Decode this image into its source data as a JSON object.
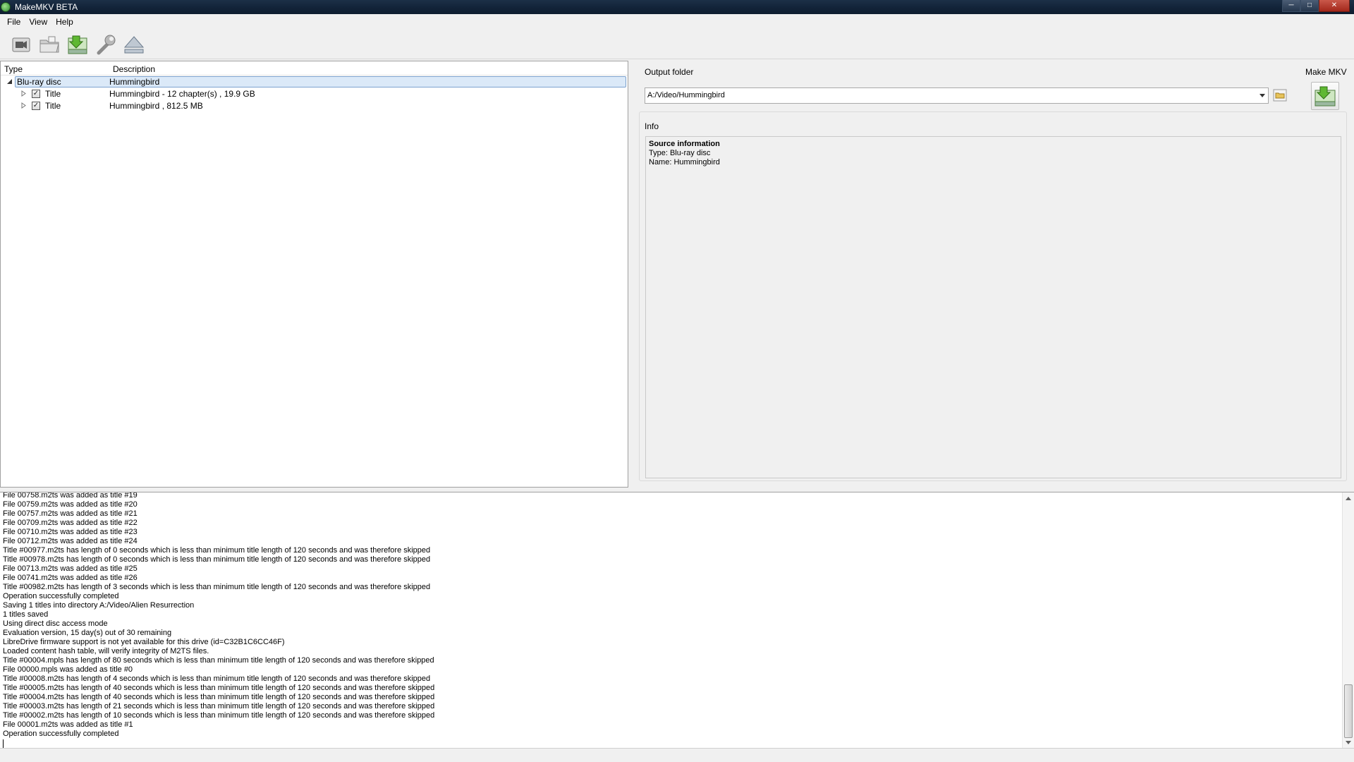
{
  "window": {
    "title": "MakeMKV BETA"
  },
  "menu": {
    "items": [
      "File",
      "View",
      "Help"
    ]
  },
  "tree": {
    "columns": {
      "type": "Type",
      "description": "Description"
    },
    "rows": [
      {
        "type": "Blu-ray disc",
        "description": "Hummingbird"
      },
      {
        "type": "Title",
        "description": "Hummingbird - 12 chapter(s) , 19.9 GB"
      },
      {
        "type": "Title",
        "description": "Hummingbird , 812.5 MB"
      }
    ]
  },
  "output": {
    "label": "Output folder",
    "value": "A:/Video/Hummingbird"
  },
  "make_mkv": {
    "label": "Make MKV"
  },
  "info": {
    "label": "Info",
    "heading": "Source information",
    "lines": [
      "Type: Blu-ray disc",
      "Name: Hummingbird"
    ]
  },
  "log": {
    "lines": [
      "File 00758.m2ts was added as title #19",
      "File 00759.m2ts was added as title #20",
      "File 00757.m2ts was added as title #21",
      "File 00709.m2ts was added as title #22",
      "File 00710.m2ts was added as title #23",
      "File 00712.m2ts was added as title #24",
      "Title #00977.m2ts has length of 0 seconds which is less than minimum title length of 120 seconds and was therefore skipped",
      "Title #00978.m2ts has length of 0 seconds which is less than minimum title length of 120 seconds and was therefore skipped",
      "File 00713.m2ts was added as title #25",
      "File 00741.m2ts was added as title #26",
      "Title #00982.m2ts has length of 3 seconds which is less than minimum title length of 120 seconds and was therefore skipped",
      "Operation successfully completed",
      "Saving 1 titles into directory A:/Video/Alien Resurrection",
      "1 titles saved",
      "Using direct disc access mode",
      "Evaluation version, 15 day(s) out of 30 remaining",
      "LibreDrive firmware support is not yet available for this drive (id=C32B1C6CC46F)",
      "Loaded content hash table, will verify integrity of M2TS files.",
      "Title #00004.mpls has length of 80 seconds which is less than minimum title length of 120 seconds and was therefore skipped",
      "File 00000.mpls was added as title #0",
      "Title #00008.m2ts has length of 4 seconds which is less than minimum title length of 120 seconds and was therefore skipped",
      "Title #00005.m2ts has length of 40 seconds which is less than minimum title length of 120 seconds and was therefore skipped",
      "Title #00004.m2ts has length of 40 seconds which is less than minimum title length of 120 seconds and was therefore skipped",
      "Title #00003.m2ts has length of 21 seconds which is less than minimum title length of 120 seconds and was therefore skipped",
      "Title #00002.m2ts has length of 10 seconds which is less than minimum title length of 120 seconds and was therefore skipped",
      "File 00001.m2ts was added as title #1",
      "Operation successfully completed"
    ]
  },
  "icons": {
    "app": "makemkv-logo-icon",
    "toolbar": [
      "open-disc-icon",
      "open-files-icon",
      "backup-icon",
      "settings-wrench-icon",
      "eject-icon"
    ],
    "colors": {
      "accent_green": "#5fb832",
      "selection": "#dbe9f8",
      "selection_border": "#7da2ce"
    }
  }
}
